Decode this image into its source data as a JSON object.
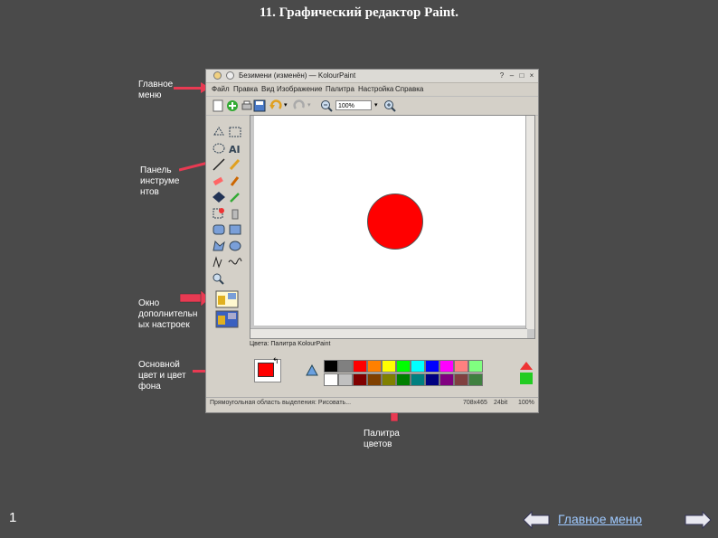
{
  "slide_title": "11. Графический редактор Paint.",
  "app": {
    "window_title": "Безимени (изменён) — KolourPaint",
    "menus": [
      "Файл",
      "Правка",
      "Вид",
      "Изображение",
      "Палитра",
      "Настройка",
      "Справка"
    ],
    "zoom": "100%",
    "palette_title": "Цвета: Палитра KolourPaint",
    "status_left": "Прямоугольная область выделения: Рисовать...",
    "status_size": "708x465",
    "status_bits": "24bit",
    "status_zoom": "100%",
    "palette_colors_top": [
      "#000000",
      "#808080",
      "#ff0000",
      "#ff8000",
      "#ffff00",
      "#00ff00",
      "#00ffff",
      "#0000ff",
      "#ff00ff",
      "#ff8080",
      "#80ff80"
    ],
    "palette_colors_bottom": [
      "#ffffff",
      "#c0c0c0",
      "#800000",
      "#804000",
      "#808000",
      "#008000",
      "#008080",
      "#000080",
      "#800080",
      "#804040",
      "#408040"
    ],
    "foreground_color": "#ff0000",
    "background_color": "#ffffff",
    "drawing_fill": "#ff0000"
  },
  "annotations": {
    "main_menu": "Главное меню",
    "toolbox": "Панель инструме нтов",
    "tool_options": "Окно дополнительн ых настроек",
    "colors": "Основной цвет и цвет фона",
    "palette": "Палитра цветов"
  },
  "footer": {
    "page_number": "1",
    "main_menu_link": "Главное меню"
  }
}
